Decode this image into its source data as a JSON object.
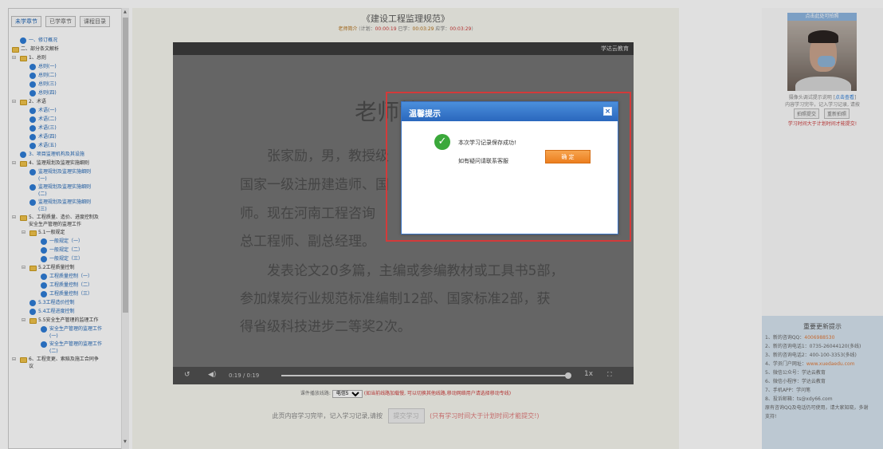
{
  "sidebar": {
    "tabs": [
      "未学章节",
      "已学章节",
      "课程目录"
    ],
    "tree": [
      {
        "label": "一、修订概况",
        "type": "lesson",
        "level": 1
      },
      {
        "label": "二、部分条文解析",
        "type": "folder",
        "level": 0
      },
      {
        "label": "1、总则",
        "type": "folder",
        "level": 1
      },
      {
        "label": "总则(一)",
        "type": "lesson",
        "level": 2
      },
      {
        "label": "总则(二)",
        "type": "lesson",
        "level": 2
      },
      {
        "label": "总则(三)",
        "type": "lesson",
        "level": 2
      },
      {
        "label": "总则(四)",
        "type": "lesson",
        "level": 2
      },
      {
        "label": "2、术语",
        "type": "folder",
        "level": 1
      },
      {
        "label": "术语(一)",
        "type": "lesson",
        "level": 2
      },
      {
        "label": "术语(二)",
        "type": "lesson",
        "level": 2
      },
      {
        "label": "术语(三)",
        "type": "lesson",
        "level": 2
      },
      {
        "label": "术语(四)",
        "type": "lesson",
        "level": 2
      },
      {
        "label": "术语(五)",
        "type": "lesson",
        "level": 2
      },
      {
        "label": "3、项目监理机构及其设施",
        "type": "lesson",
        "level": 1
      },
      {
        "label": "4、监理规划及监理实施细则",
        "type": "folder",
        "level": 1
      },
      {
        "label": "监理规划及监理实施细则",
        "label2": "(一)",
        "type": "lesson",
        "level": 2
      },
      {
        "label": "监理规划及监理实施细则",
        "label2": "(二)",
        "type": "lesson",
        "level": 2
      },
      {
        "label": "监理规划及监理实施细则",
        "label2": "(三)",
        "type": "lesson",
        "level": 2
      },
      {
        "label": "5、工程质量、造价、进度控制及",
        "label2": "安全生产管理的监理工作",
        "type": "folder",
        "level": 1
      },
      {
        "label": "5.1一般规定",
        "type": "folder",
        "level": 2
      },
      {
        "label": "一般规定（一）",
        "type": "lesson",
        "level": 3
      },
      {
        "label": "一般规定（二）",
        "type": "lesson",
        "level": 3
      },
      {
        "label": "一般规定（三）",
        "type": "lesson",
        "level": 3
      },
      {
        "label": "5.2工程质量控制",
        "type": "folder",
        "level": 2
      },
      {
        "label": "工程质量控制（一）",
        "type": "lesson",
        "level": 3
      },
      {
        "label": "工程质量控制（二）",
        "type": "lesson",
        "level": 3
      },
      {
        "label": "工程质量控制（三）",
        "type": "lesson",
        "level": 3
      },
      {
        "label": "5.3工程造价控制",
        "type": "lesson",
        "level": 2
      },
      {
        "label": "5.4工程进度控制",
        "type": "lesson",
        "level": 2
      },
      {
        "label": "5.5安全生产管理的监理工作",
        "type": "folder",
        "level": 2
      },
      {
        "label": "安全生产管理的监理工作",
        "label2": "(一)",
        "type": "lesson",
        "level": 3
      },
      {
        "label": "安全生产管理的监理工作",
        "label2": "(二)",
        "type": "lesson",
        "level": 3
      },
      {
        "label": "6、工程变更、索赔及施工合同争",
        "label2": "议",
        "type": "folder",
        "level": 1
      }
    ]
  },
  "course": {
    "title": "《建设工程监理规范》",
    "teacher_intro": "老师简介",
    "plan_label": "计划：",
    "plan_time": "00:00:19",
    "learned_label": "已学：",
    "learned_time": "00:03:29",
    "required_label": "应学：",
    "required_time": "00:03:29"
  },
  "video": {
    "brand": "学达云教育",
    "slide_title": "老师简介",
    "slide_lines": [
      "张家励，男，教授级",
      "国家一级注册建造师、国",
      "师。现在河南工程咨询",
      "总工程师、副总经理。",
      "发表论文20多篇，主编或参编教材或工具书5部，",
      "参加煤炭行业规范标准编制12部、国家标准2部，获",
      "得省级科技进步二等奖2次。"
    ],
    "time": "0:19 / 0:19",
    "speed": "1x",
    "progress": 1.0
  },
  "line_switch": {
    "label": "课件播放线路:",
    "selected": "电信5",
    "warning": "(如当前线路加载慢, 可以切换其他线路,移动网络用户请选择移动专线)"
  },
  "submit": {
    "prefix": "此页内容学习完毕，记入学习记录,请按",
    "button": "提交学习",
    "warning": "(只有学习时间大于计划时间才能提交!)"
  },
  "right_panel": {
    "camera_header": "点击此处可拍照",
    "camera_tip1": "摄像头调试提示说明",
    "camera_tip1_link": "点击查看",
    "camera_tip2": "内容学习完毕，记入学习记录, 请按",
    "btn_photo": "拍照提交",
    "btn_reshoot": "重新拍照",
    "warn": "学习时间大于计划时间才能提交!",
    "notice_title": "重要更新提示",
    "notice_items": [
      {
        "text": "1、新的咨询QQ：",
        "hl": "4006988530"
      },
      {
        "text": "2、新的咨询电话1：0735-26044120(多线)",
        "hl": ""
      },
      {
        "text": "3、新的咨询电话2：400-100-3353(多线)",
        "hl": ""
      },
      {
        "text": "4、学员门户网址：",
        "hl": "www.xuedaedu.com"
      },
      {
        "text": "5、微信公众号：学达云教育",
        "hl": ""
      },
      {
        "text": "6、微信小程序：学达云教育",
        "hl": ""
      },
      {
        "text": "7、手机APP：学问笔",
        "hl": ""
      },
      {
        "text": "8、投诉邮箱：ts@xdy66.com",
        "hl": ""
      },
      {
        "text": "原有咨询QQ及电话仍可使用，请大家知晓，多谢",
        "hl": ""
      },
      {
        "text": "支持!",
        "hl": ""
      }
    ]
  },
  "dialog": {
    "title": "温馨提示",
    "close_glyph": "×",
    "message": "本次学习记录保存成功!",
    "contact": "如有疑问请联系客服",
    "ok_label": "确 定"
  },
  "colors": {
    "accent_blue": "#2a67bd",
    "ok_orange": "#ec7e1e",
    "warn_red": "#cc3b3b",
    "highlight_frame": "#d33a3a"
  }
}
